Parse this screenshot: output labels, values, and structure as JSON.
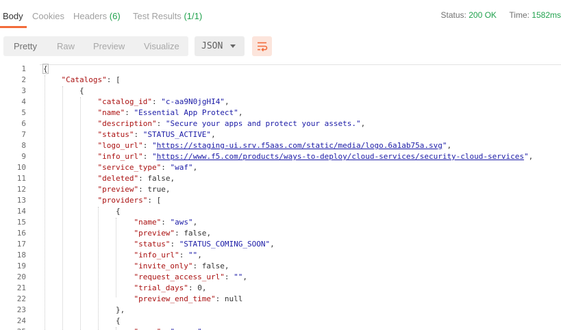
{
  "tabs": [
    {
      "label": "Body",
      "count": "",
      "active": true
    },
    {
      "label": "Cookies",
      "count": "",
      "active": false
    },
    {
      "label": "Headers",
      "count": "(6)",
      "active": false
    },
    {
      "label": "Test Results",
      "count": "(1/1)",
      "active": false
    }
  ],
  "status": {
    "status_label": "Status:",
    "status_value": "200 OK",
    "time_label": "Time:",
    "time_value": "1582ms"
  },
  "toolbar": {
    "views": [
      "Pretty",
      "Raw",
      "Preview",
      "Visualize"
    ],
    "active_view": "Pretty",
    "format": "JSON",
    "wrap_icon": "wrap-lines-icon"
  },
  "colors": {
    "accent": "#f26b3a",
    "success": "#1fa14c",
    "json_key": "#aa1111",
    "json_string": "#1a1aa6"
  },
  "code_lines": [
    {
      "n": "1",
      "text": "{"
    },
    {
      "n": "2",
      "text": "    \"Catalogs\": ["
    },
    {
      "n": "3",
      "text": "        {"
    },
    {
      "n": "4",
      "text": "            \"catalog_id\": \"c-aa9N0jgHI4\","
    },
    {
      "n": "5",
      "text": "            \"name\": \"Essential App Protect\","
    },
    {
      "n": "6",
      "text": "            \"description\": \"Secure your apps and protect your assets.\","
    },
    {
      "n": "7",
      "text": "            \"status\": \"STATUS_ACTIVE\","
    },
    {
      "n": "8",
      "text": "            \"logo_url\": \"https://staging-ui.srv.f5aas.com/static/media/logo.6a1ab75a.svg\","
    },
    {
      "n": "9",
      "text": "            \"info_url\": \"https://www.f5.com/products/ways-to-deploy/cloud-services/security-cloud-services\","
    },
    {
      "n": "10",
      "text": "            \"service_type\": \"waf\","
    },
    {
      "n": "11",
      "text": "            \"deleted\": false,"
    },
    {
      "n": "12",
      "text": "            \"preview\": true,"
    },
    {
      "n": "13",
      "text": "            \"providers\": ["
    },
    {
      "n": "14",
      "text": "                {"
    },
    {
      "n": "15",
      "text": "                    \"name\": \"aws\","
    },
    {
      "n": "16",
      "text": "                    \"preview\": false,"
    },
    {
      "n": "17",
      "text": "                    \"status\": \"STATUS_COMING_SOON\","
    },
    {
      "n": "18",
      "text": "                    \"info_url\": \"\","
    },
    {
      "n": "19",
      "text": "                    \"invite_only\": false,"
    },
    {
      "n": "20",
      "text": "                    \"request_access_url\": \"\","
    },
    {
      "n": "21",
      "text": "                    \"trial_days\": 0,"
    },
    {
      "n": "22",
      "text": "                    \"preview_end_time\": null"
    },
    {
      "n": "23",
      "text": "                },"
    },
    {
      "n": "24",
      "text": "                {"
    },
    {
      "n": "25",
      "text": "                    \"name\": \"azure\","
    }
  ]
}
